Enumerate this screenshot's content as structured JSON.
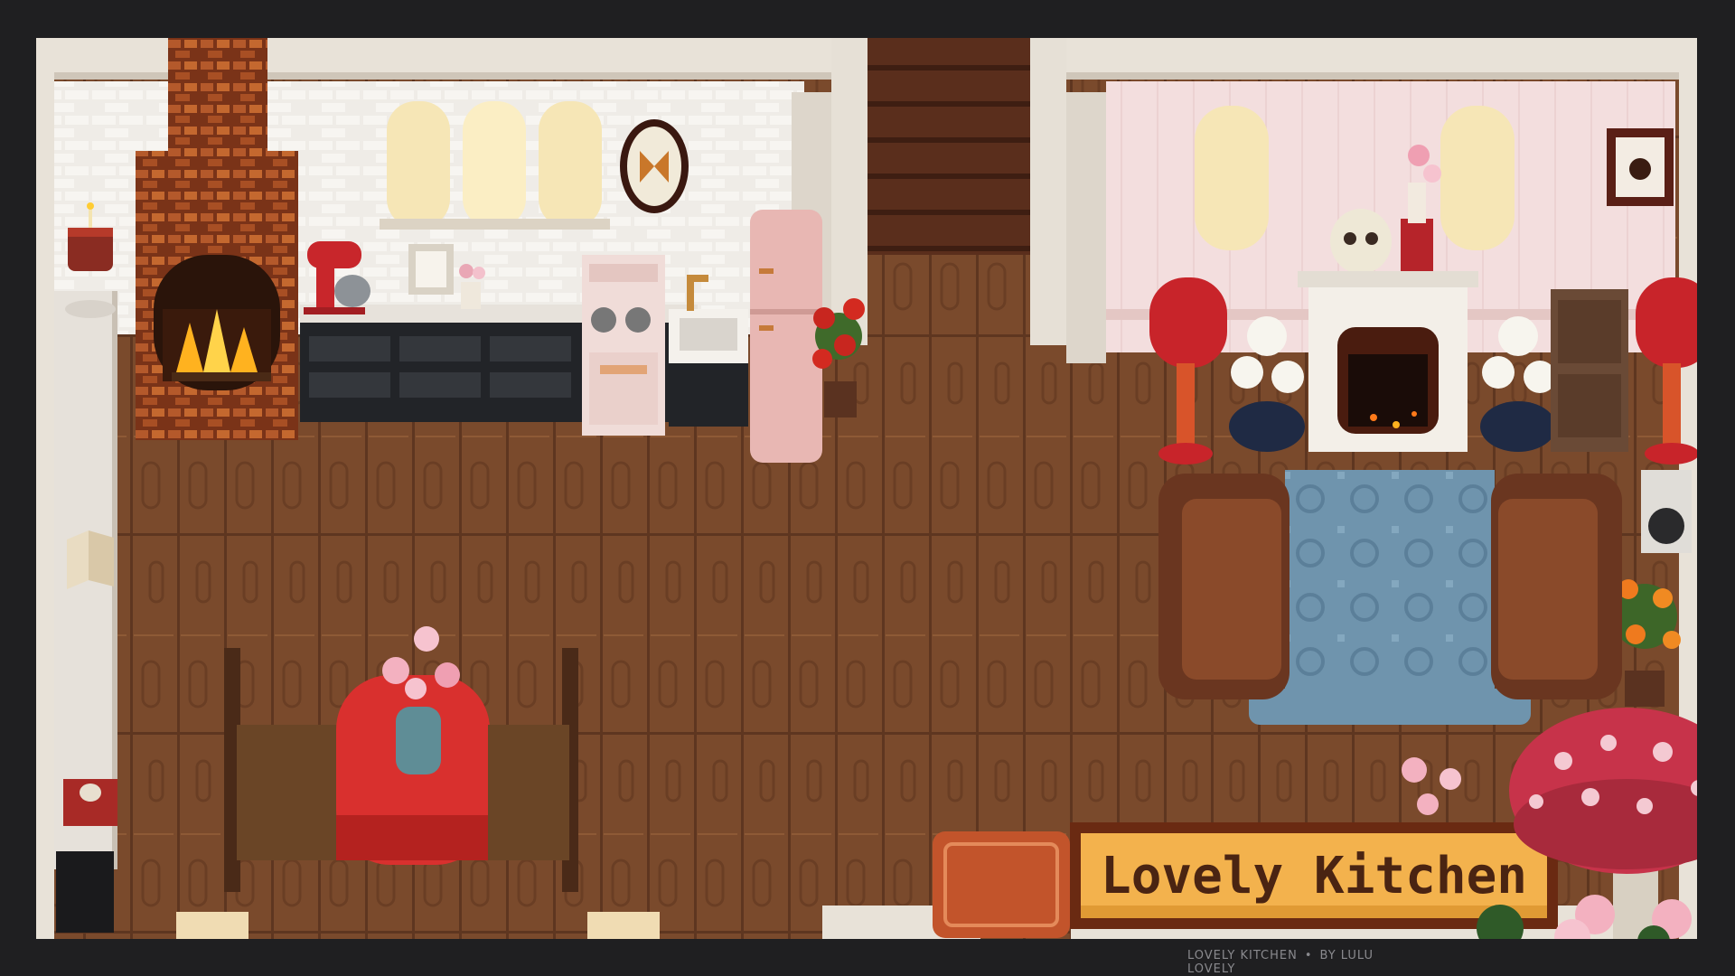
{
  "scene": {
    "title": "Lovely Kitchen",
    "credit_title": "LOVELY KITCHEN",
    "credit_separator": "•",
    "credit_author": "BY LULU LOVELY"
  },
  "palette": {
    "frame": "#1f1f21",
    "floor": "#7a4a2c",
    "floor_dark": "#5e3620",
    "wall_brick": "#ece9e4",
    "wall_pink": "#f3dede",
    "trim": "#e8e2d8",
    "fireplace_brick": "#a9532a",
    "fire": "#ffb21f",
    "tablecloth": "#d9302e",
    "rug": "#6f94ad",
    "armchair": "#6a3620",
    "mushroom_cap": "#c7334a",
    "banner": "#f3b24d",
    "banner_text": "#4a2412",
    "fridge": "#e8b7b3",
    "counter": "#222428"
  },
  "icons": [
    "fireplace-icon",
    "window-icon",
    "butterfly-frame-icon",
    "mixer-icon",
    "stove-icon",
    "sink-icon",
    "fridge-icon",
    "plant-icon",
    "skull-icon",
    "lamp-icon",
    "armchair-icon",
    "rug-icon",
    "mushroom-table-icon",
    "flower-vase-icon",
    "dining-table-icon",
    "chair-icon",
    "book-icon",
    "record-player-icon",
    "cake-icon",
    "picture-frame-icon"
  ]
}
